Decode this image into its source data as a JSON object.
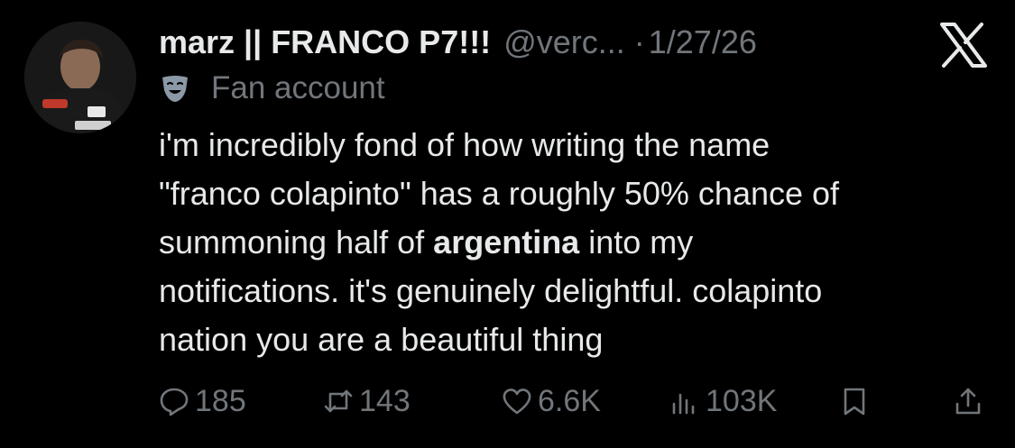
{
  "post": {
    "display_name": "marz || FRANCO P7!!!",
    "handle": "@verc...",
    "separator": "·",
    "date": "1/27/26",
    "label": "Fan account",
    "lines": [
      "i'm incredibly fond of how writing the name",
      "\"franco colapinto\" has a roughly 50% chance of",
      "summoning half of",
      "argentina",
      "into my",
      "notifications. it's genuinely delightful. colapinto",
      "nation you are a beautiful thing"
    ]
  },
  "metrics": {
    "replies": "185",
    "reposts": "143",
    "likes": "6.6K",
    "views": "103K"
  },
  "icons": {
    "avatar": "profile-photo",
    "platform": "x-logo",
    "label": "theater-mask-icon",
    "reply": "reply-icon",
    "repost": "repost-icon",
    "like": "heart-icon",
    "views": "views-icon",
    "bookmark": "bookmark-icon",
    "share": "share-icon"
  },
  "colors": {
    "background": "#000000",
    "text": "#e7e9ea",
    "muted": "#71767b"
  }
}
